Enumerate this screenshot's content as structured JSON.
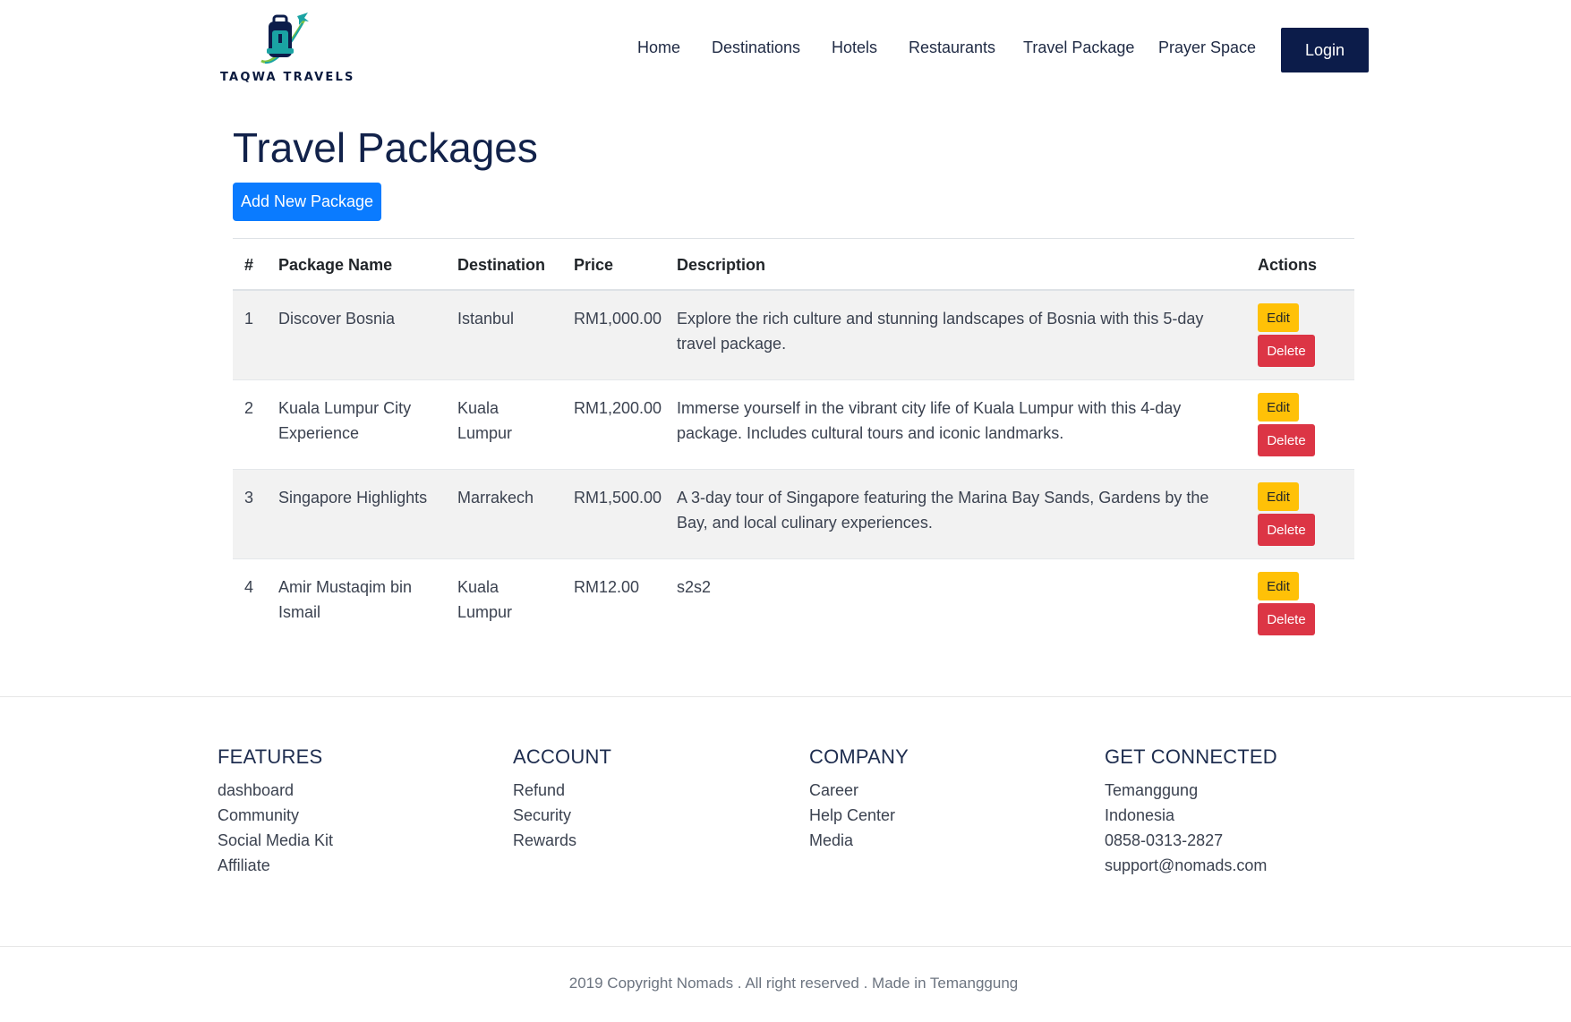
{
  "brand": {
    "name": "TAQWA TRAVELS",
    "logo_icon": "backpack-airplane-icon",
    "colors": {
      "navy": "#0c1c4a",
      "teal": "#1aa3a3",
      "green": "#7cc242"
    }
  },
  "nav": {
    "links": [
      "Home",
      "Destinations",
      "Hotels",
      "Restaurants",
      "Travel Package",
      "Prayer Space"
    ],
    "login_label": "Login"
  },
  "main": {
    "title": "Travel Packages",
    "add_button_label": "Add New Package",
    "table": {
      "columns": [
        "#",
        "Package Name",
        "Destination",
        "Price",
        "Description",
        "Actions"
      ],
      "rows": [
        {
          "id": "1",
          "name": "Discover Bosnia",
          "destination": "Istanbul",
          "price": "RM1,000.00",
          "description": "Explore the rich culture and stunning landscapes of Bosnia with this 5-day travel package."
        },
        {
          "id": "2",
          "name": "Kuala Lumpur City Experience",
          "destination": "Kuala Lumpur",
          "price": "RM1,200.00",
          "description": "Immerse yourself in the vibrant city life of Kuala Lumpur with this 4-day package. Includes cultural tours and iconic landmarks."
        },
        {
          "id": "3",
          "name": "Singapore Highlights",
          "destination": "Marrakech",
          "price": "RM1,500.00",
          "description": "A 3-day tour of Singapore featuring the Marina Bay Sands, Gardens by the Bay, and local culinary experiences."
        },
        {
          "id": "4",
          "name": "Amir Mustaqim bin Ismail",
          "destination": "Kuala Lumpur",
          "price": "RM12.00",
          "description": "s2s2"
        }
      ],
      "edit_label": "Edit",
      "delete_label": "Delete"
    }
  },
  "footer": {
    "columns": [
      {
        "heading": "FEATURES",
        "items": [
          "dashboard",
          "Community",
          "Social Media Kit",
          "Affiliate"
        ]
      },
      {
        "heading": "ACCOUNT",
        "items": [
          "Refund",
          "Security",
          "Rewards"
        ]
      },
      {
        "heading": "COMPANY",
        "items": [
          "Career",
          "Help Center",
          "Media"
        ]
      },
      {
        "heading": "GET CONNECTED",
        "items": [
          "Temanggung",
          "Indonesia",
          "0858-0313-2827",
          "support@nomads.com"
        ]
      }
    ],
    "copyright": "2019 Copyright Nomads . All right reserved . Made in Temanggung"
  }
}
